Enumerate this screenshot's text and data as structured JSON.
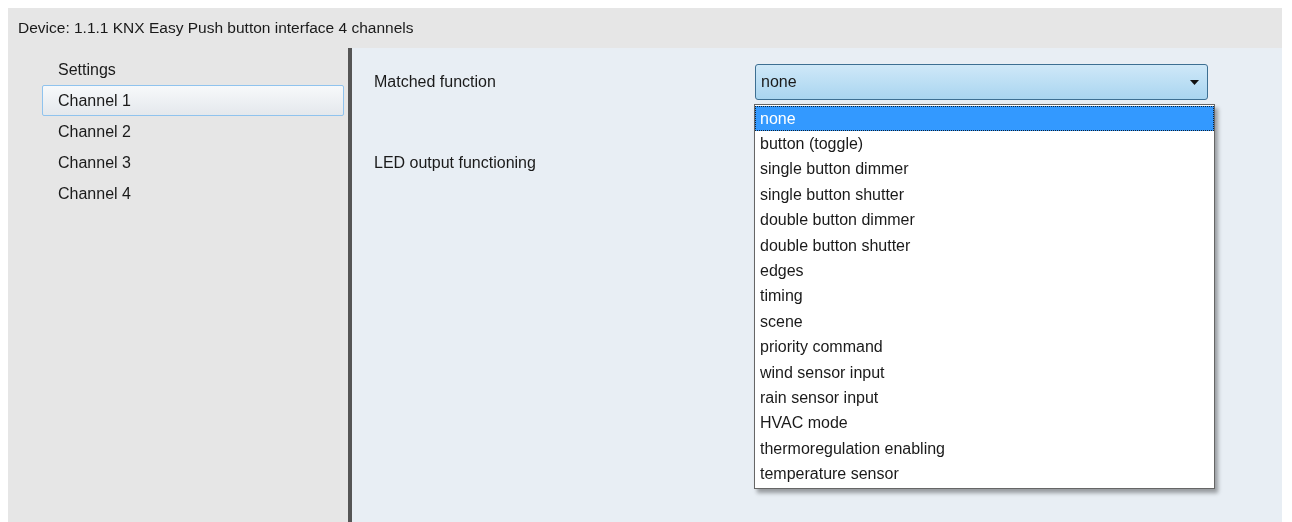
{
  "window": {
    "title": "Device: 1.1.1  KNX Easy Push button interface 4 channels"
  },
  "sidebar": {
    "items": [
      {
        "label": "Settings",
        "selected": false
      },
      {
        "label": "Channel 1",
        "selected": true
      },
      {
        "label": "Channel 2",
        "selected": false
      },
      {
        "label": "Channel 3",
        "selected": false
      },
      {
        "label": "Channel 4",
        "selected": false
      }
    ]
  },
  "parameters": [
    {
      "label": "Matched function",
      "kind": "dropdown",
      "value": "none",
      "expanded": true,
      "options": [
        {
          "label": "none",
          "selected": true
        },
        {
          "label": "button (toggle)",
          "selected": false
        },
        {
          "label": "single button dimmer",
          "selected": false
        },
        {
          "label": "single button shutter",
          "selected": false
        },
        {
          "label": "double button dimmer",
          "selected": false
        },
        {
          "label": "double button shutter",
          "selected": false
        },
        {
          "label": "edges",
          "selected": false
        },
        {
          "label": "timing",
          "selected": false
        },
        {
          "label": "scene",
          "selected": false
        },
        {
          "label": "priority command",
          "selected": false
        },
        {
          "label": "wind sensor input",
          "selected": false
        },
        {
          "label": "rain sensor input",
          "selected": false
        },
        {
          "label": "HVAC mode",
          "selected": false
        },
        {
          "label": "thermoregulation enabling",
          "selected": false
        },
        {
          "label": "temperature sensor",
          "selected": false
        }
      ]
    },
    {
      "label": "LED output functioning",
      "kind": "hidden"
    }
  ]
}
